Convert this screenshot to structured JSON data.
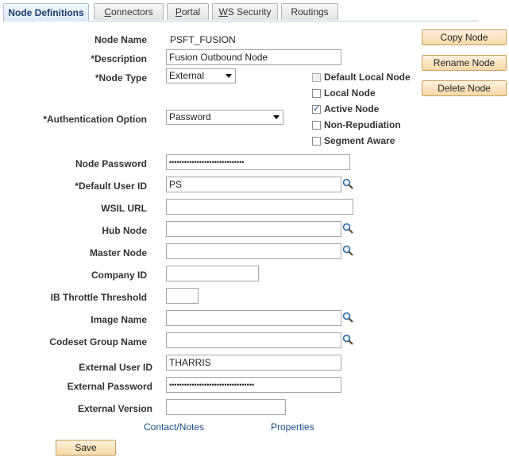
{
  "tabs": [
    {
      "label": "Node Definitions",
      "active": true
    },
    {
      "label": "Connectors",
      "underline_char": "C",
      "rest": "onnectors"
    },
    {
      "label": "Portal",
      "underline_char": "P",
      "rest": "ortal"
    },
    {
      "label": "WS Security",
      "underline_char": "W",
      "rest": "S Security"
    },
    {
      "label": "Routings",
      "underline_char": "",
      "rest": "Routings"
    }
  ],
  "fields": {
    "node_name_label": "Node Name",
    "node_name_value": "PSFT_FUSION",
    "description_label": "*Description",
    "description_value": "Fusion Outbound Node",
    "node_type_label": "*Node Type",
    "node_type_value": "External",
    "auth_label": "*Authentication Option",
    "auth_value": "Password",
    "node_password_label": "Node Password",
    "node_password_value": "••••••••••••••••••••••••••••••",
    "default_user_label": "*Default User ID",
    "default_user_value": "PS",
    "wsil_label": "WSIL URL",
    "wsil_value": "",
    "hub_node_label": "Hub Node",
    "hub_node_value": "",
    "master_node_label": "Master Node",
    "master_node_value": "",
    "company_id_label": "Company ID",
    "company_id_value": "",
    "throttle_label": "IB Throttle Threshold",
    "throttle_value": "",
    "image_name_label": "Image Name",
    "image_name_value": "",
    "codeset_label": "Codeset Group Name",
    "codeset_value": "",
    "ext_user_label": "External User ID",
    "ext_user_value": "THARRIS",
    "ext_password_label": "External Password",
    "ext_password_value": "••••••••••••••••••••••••••••••••••",
    "ext_version_label": "External Version",
    "ext_version_value": ""
  },
  "checkboxes": {
    "default_local": {
      "label": "Default Local Node",
      "checked": false,
      "disabled": true
    },
    "local": {
      "label": "Local Node",
      "checked": false,
      "disabled": false
    },
    "active": {
      "label": "Active Node",
      "checked": true,
      "disabled": false
    },
    "non_repudiation": {
      "label": "Non-Repudiation",
      "checked": false,
      "disabled": false
    },
    "segment_aware": {
      "label": "Segment Aware",
      "checked": false,
      "disabled": false
    }
  },
  "buttons": {
    "copy": "Copy Node",
    "rename": "Rename Node",
    "delete": "Delete Node",
    "save": "Save"
  },
  "links": {
    "contact": "Contact/Notes",
    "properties": "Properties"
  },
  "icons": {
    "lookup": "magnifier-icon",
    "dropdown": "chevron-down-icon",
    "check": "checkmark-icon"
  },
  "colors": {
    "button_bg": "#f6d9a8",
    "link": "#1f4f8f",
    "tab_active_text": "#1b3f6b"
  }
}
